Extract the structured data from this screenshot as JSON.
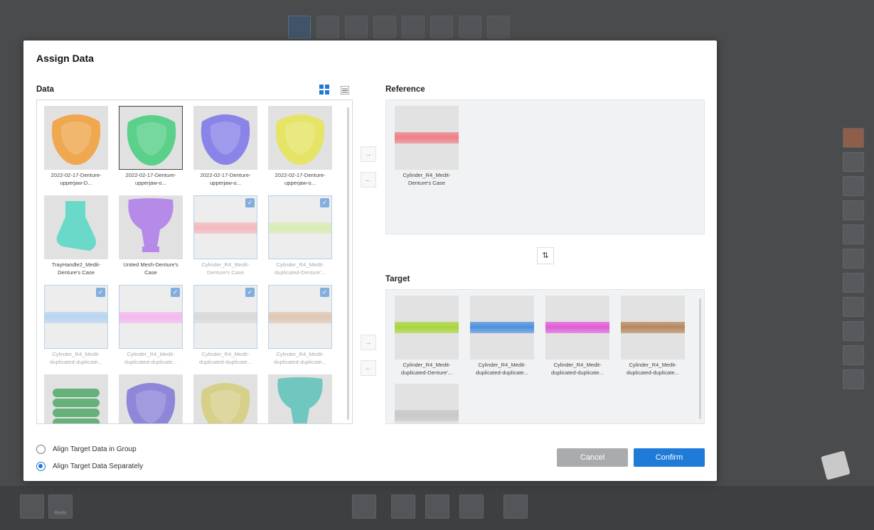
{
  "dialog": {
    "title": "Assign Data",
    "data_label": "Data",
    "reference_label": "Reference",
    "target_label": "Target"
  },
  "data_items": [
    {
      "label": "2022-02-17-Denture-upperjaw-D...",
      "color": "#f0a850",
      "kind": "tray",
      "state": "normal"
    },
    {
      "label": "2022-02-17-Denture-upperjaw-o...",
      "color": "#5ad08a",
      "kind": "tray",
      "state": "selected"
    },
    {
      "label": "2022-02-17-Denture-upperjaw-o...",
      "color": "#8a84e8",
      "kind": "tray",
      "state": "normal"
    },
    {
      "label": "2022-02-17-Denture-upperjaw-o...",
      "color": "#e6e466",
      "kind": "tray",
      "state": "normal"
    },
    {
      "label": "TrayHandle2_Medit-Denture's Case",
      "color": "#6bd9c9",
      "kind": "handle",
      "state": "normal"
    },
    {
      "label": "United Mesh-Denture's Case",
      "color": "#b58ae8",
      "kind": "cup",
      "state": "normal"
    },
    {
      "label": "Cylinder_R4_Medit-Denture's Case",
      "color": "#f2b8bc",
      "kind": "tube",
      "state": "checked"
    },
    {
      "label": "Cylinder_R4_Medit-duplicated-Denture'...",
      "color": "#d7ecb2",
      "kind": "tube",
      "state": "checked"
    },
    {
      "label": "Cylinder_R4_Medit-duplicated-duplicate...",
      "color": "#b7d4f0",
      "kind": "tube",
      "state": "checked"
    },
    {
      "label": "Cylinder_R4_Medit-duplicated-duplicate...",
      "color": "#f4b7ee",
      "kind": "tube",
      "state": "checked"
    },
    {
      "label": "Cylinder_R4_Medit-duplicated-duplicate...",
      "color": "#d9d9d9",
      "kind": "tube",
      "state": "checked"
    },
    {
      "label": "Cylinder_R4_Medit-duplicated-duplicate...",
      "color": "#dfc6b2",
      "kind": "tube",
      "state": "checked"
    },
    {
      "label": "",
      "color": "#66b07a",
      "kind": "coil",
      "state": "normal"
    },
    {
      "label": "",
      "color": "#8e86d8",
      "kind": "tray",
      "state": "normal"
    },
    {
      "label": "",
      "color": "#d6d08a",
      "kind": "tray",
      "state": "normal"
    },
    {
      "label": "",
      "color": "#6fc7c0",
      "kind": "cup",
      "state": "normal"
    }
  ],
  "reference_items": [
    {
      "label": "Cylinder_R4_Medit-Denture's Case",
      "color": "#ee7e86"
    }
  ],
  "target_items": [
    {
      "label": "Cylinder_R4_Medit-duplicated-Denture'...",
      "color": "#a9d63a"
    },
    {
      "label": "Cylinder_R4_Medit-duplicated-duplicate...",
      "color": "#4a8fe0"
    },
    {
      "label": "Cylinder_R4_Medit-duplicated-duplicate...",
      "color": "#e15ad8"
    },
    {
      "label": "Cylinder_R4_Medit-duplicated-duplicate...",
      "color": "#b7875c"
    },
    {
      "label": "",
      "color": "#c8c8c8"
    }
  ],
  "options": {
    "align_group": "Align Target Data in Group",
    "align_separately": "Align Target Data Separately",
    "selected": "separately"
  },
  "buttons": {
    "cancel": "Cancel",
    "confirm": "Confirm"
  },
  "toolbar": {
    "redo_label": "Redo"
  },
  "colors": {
    "accent": "#1e7bd8",
    "selected_check": "#82aede"
  },
  "icons": {
    "grid_view": "grid-view-icon",
    "list_view": "list-view-icon",
    "arrow_right": "→",
    "arrow_left": "←",
    "swap": "⇅",
    "check": "✓"
  }
}
